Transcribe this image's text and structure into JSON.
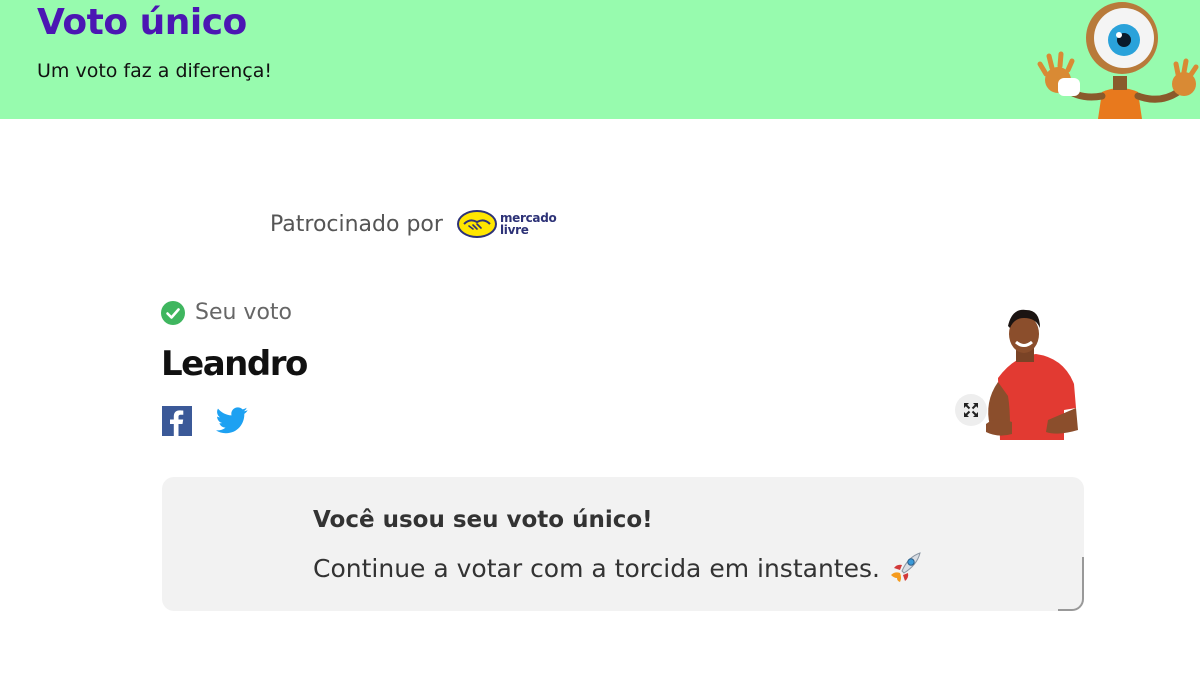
{
  "header": {
    "title": "Voto único",
    "subtitle": "Um voto faz a diferença!",
    "background_color": "#97fbae",
    "title_color": "#4b16b3",
    "mascot_icon": "big-brother-eye-mascot"
  },
  "sponsor": {
    "label": "Patrocinado por",
    "logo_line1": "mercado",
    "logo_line2": "livre",
    "logo_icon": "handshake-icon"
  },
  "vote": {
    "status_label": "Seu voto",
    "status_icon": "check-circle-icon",
    "candidate_name": "Leandro",
    "share": {
      "facebook_icon": "facebook-icon",
      "twitter_icon": "twitter-icon"
    },
    "expand_icon": "expand-icon"
  },
  "info": {
    "title": "Você usou seu voto único!",
    "text": "Continue a votar com a torcida em instantes.",
    "icon": "rocket-icon"
  }
}
